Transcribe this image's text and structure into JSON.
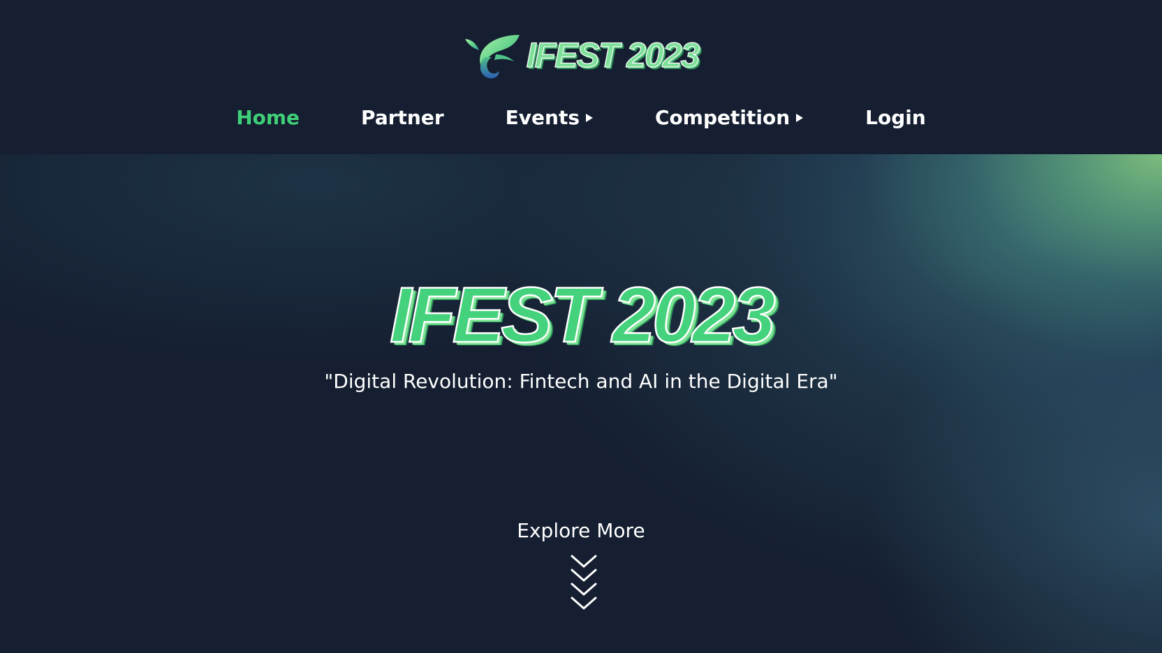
{
  "header": {
    "brand_title": "IFEST 2023",
    "logo_icon": "leaf-swirl-logo-icon",
    "nav": [
      {
        "label": "Home",
        "active": true,
        "has_caret": false
      },
      {
        "label": "Partner",
        "active": false,
        "has_caret": false
      },
      {
        "label": "Events",
        "active": false,
        "has_caret": true,
        "caret_icon": "caret-right-icon"
      },
      {
        "label": "Competition",
        "active": false,
        "has_caret": true,
        "caret_icon": "caret-right-icon"
      },
      {
        "label": "Login",
        "active": false,
        "has_caret": false
      }
    ]
  },
  "hero": {
    "title": "IFEST 2023",
    "tagline": "\"Digital Revolution: Fintech and AI in the Digital Era\"",
    "explore_label": "Explore More",
    "explore_icon": "chevrons-down-icon"
  },
  "colors": {
    "background": "#151f31",
    "accent_green": "#3fcf78",
    "title_green": "#45d27c",
    "gradient_corner": "#80c480"
  }
}
